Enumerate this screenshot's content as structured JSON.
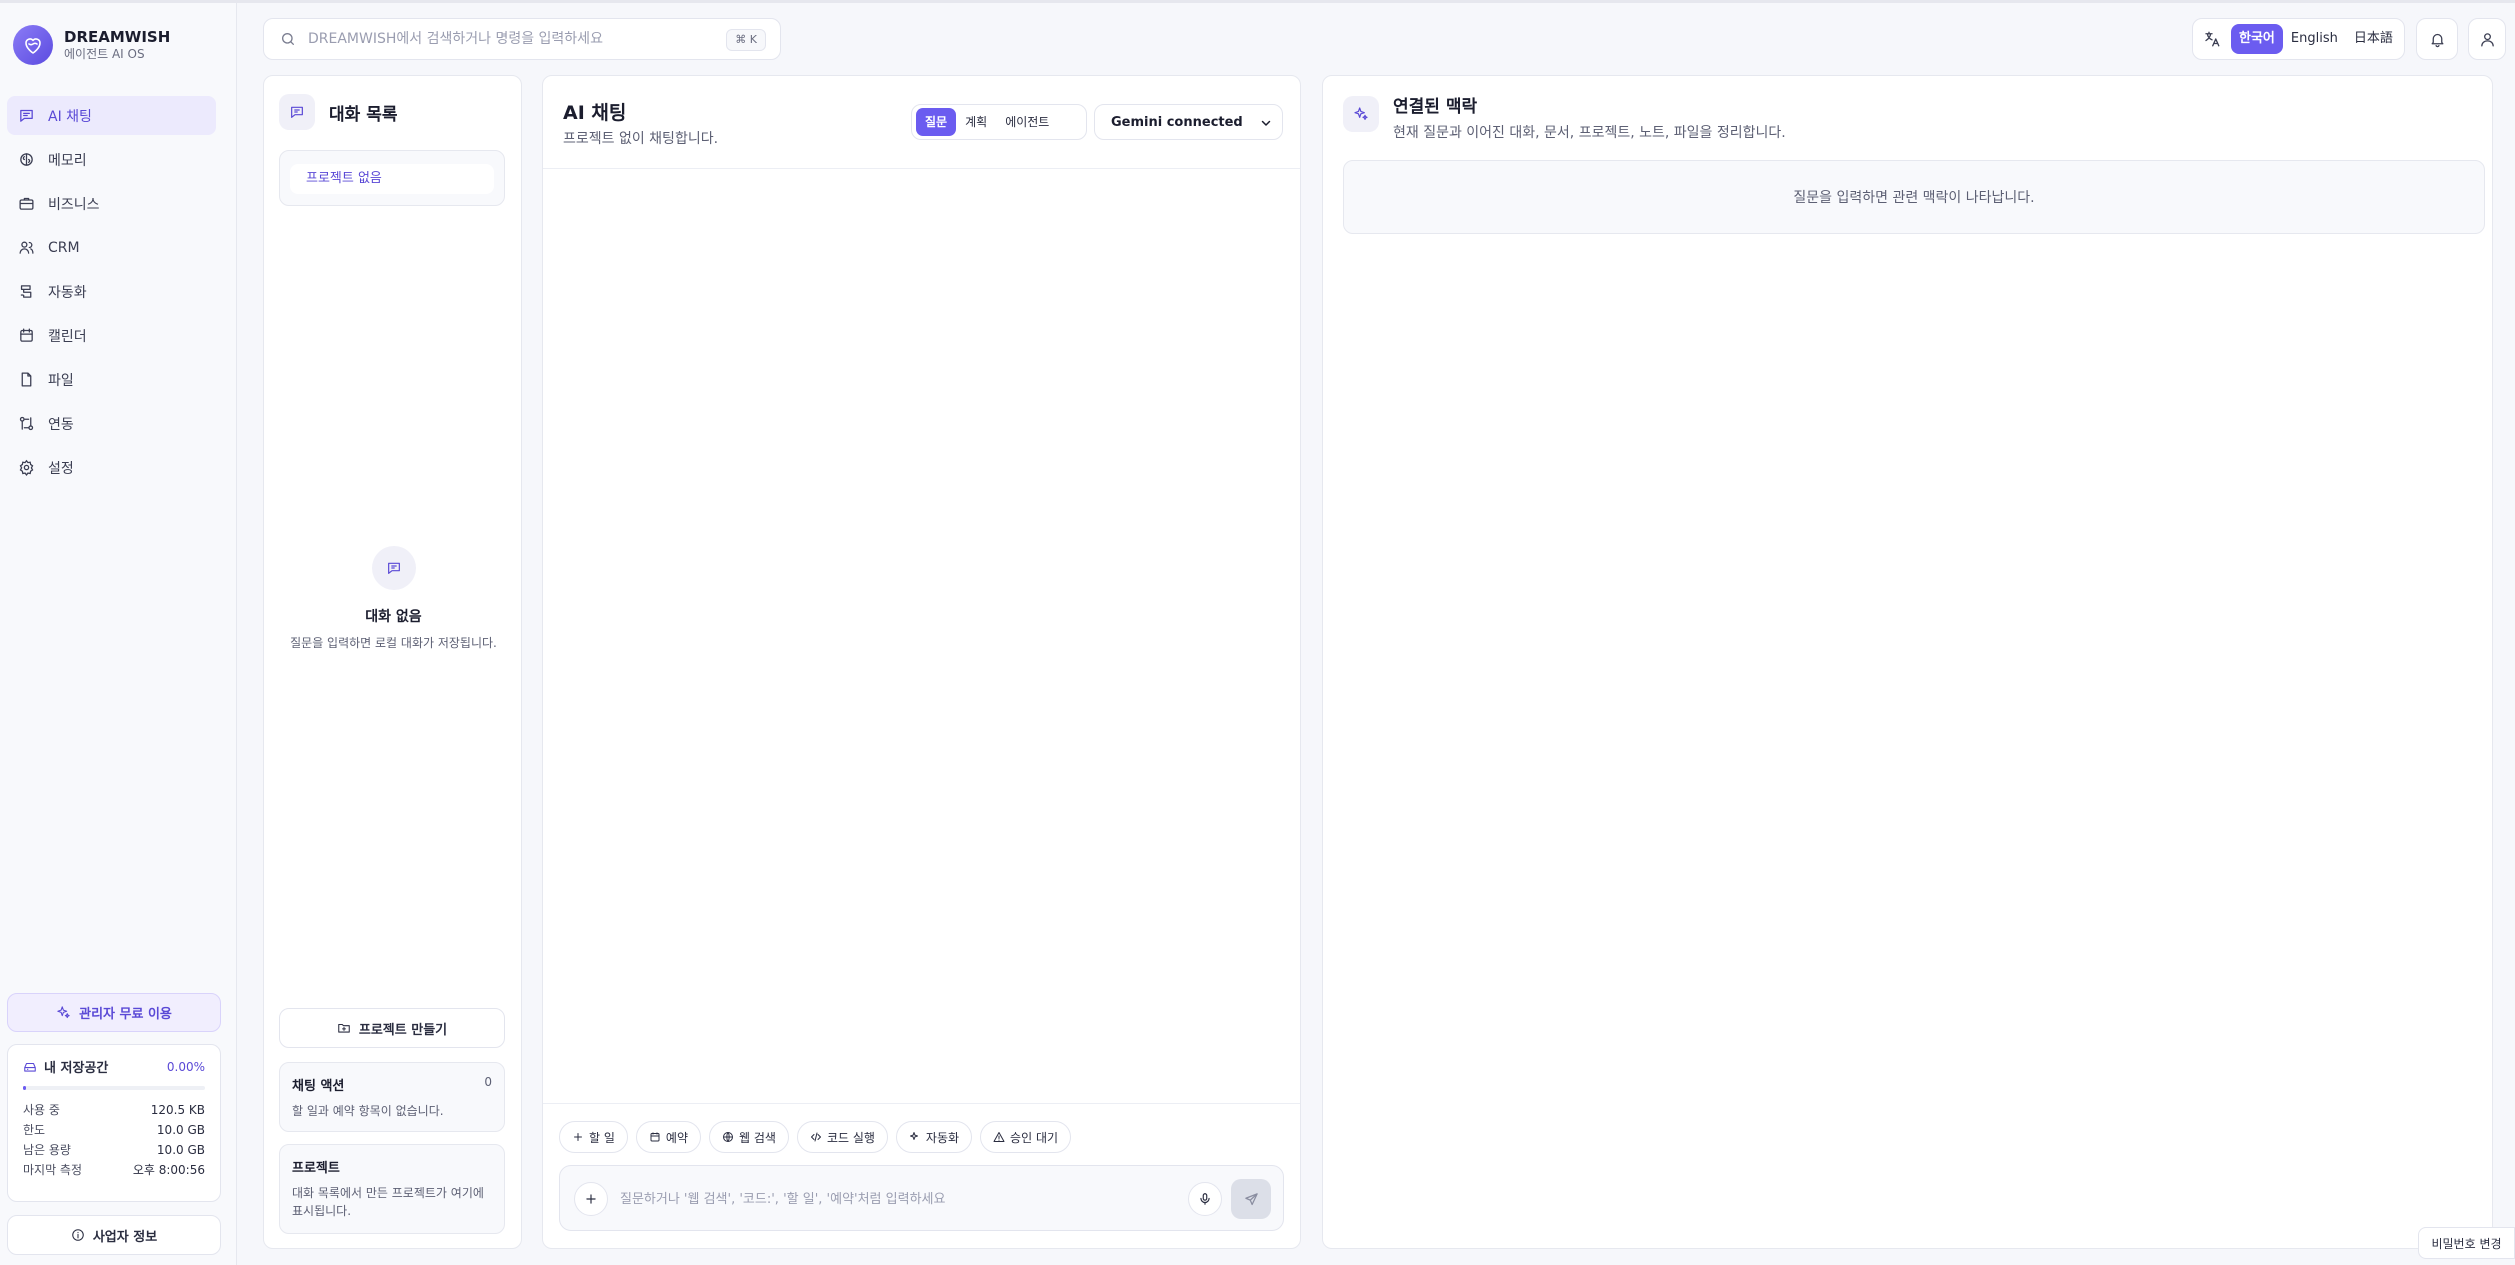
{
  "brand": {
    "name": "DREAMWISH",
    "subtitle": "에이전트 AI OS"
  },
  "sidebar": {
    "items": [
      {
        "label": "AI 채팅",
        "icon": "chat-icon",
        "active": true
      },
      {
        "label": "메모리",
        "icon": "memory-icon"
      },
      {
        "label": "비즈니스",
        "icon": "briefcase-icon"
      },
      {
        "label": "CRM",
        "icon": "users-icon"
      },
      {
        "label": "자동화",
        "icon": "workflow-icon"
      },
      {
        "label": "캘린더",
        "icon": "calendar-icon"
      },
      {
        "label": "파일",
        "icon": "file-icon"
      },
      {
        "label": "연동",
        "icon": "integration-icon"
      },
      {
        "label": "설정",
        "icon": "gear-icon"
      }
    ],
    "admin_free": "관리자 무료 이용",
    "storage": {
      "title": "내 저장공간",
      "percent": "0.00%",
      "used_fraction": 0.0,
      "rows": [
        {
          "label": "사용 중",
          "value": "120.5 KB"
        },
        {
          "label": "한도",
          "value": "10.0 GB"
        },
        {
          "label": "남은 용량",
          "value": "10.0 GB"
        },
        {
          "label": "마지막 측정",
          "value": "오후 8:00:56"
        }
      ]
    },
    "business_info": "사업자 정보"
  },
  "search": {
    "placeholder": "DREAMWISH에서 검색하거나 명령을 입력하세요",
    "shortcut": "⌘ K"
  },
  "languages": {
    "items": [
      "한국어",
      "English",
      "日本語"
    ],
    "active": "한국어"
  },
  "conversations": {
    "title": "대화 목록",
    "project_filter": "프로젝트 없음",
    "empty_title": "대화 없음",
    "empty_desc": "질문을 입력하면 로컬 대화가 저장됩니다.",
    "make_project": "프로젝트 만들기",
    "chat_actions": {
      "title": "채팅 액션",
      "count": "0",
      "desc": "할 일과 예약 항목이 없습니다."
    },
    "projects": {
      "title": "프로젝트",
      "desc": "대화 목록에서 만든 프로젝트가 여기에 표시됩니다."
    }
  },
  "chat": {
    "title": "AI 채팅",
    "subtitle": "프로젝트 없이 채팅합니다.",
    "modes": [
      "질문",
      "계획",
      "에이전트"
    ],
    "active_mode": "질문",
    "model": "Gemini connected",
    "chips": [
      {
        "label": "할 일",
        "icon": "plus-icon"
      },
      {
        "label": "예약",
        "icon": "calendar-icon"
      },
      {
        "label": "웹 검색",
        "icon": "globe-icon"
      },
      {
        "label": "코드 실행",
        "icon": "code-icon"
      },
      {
        "label": "자동화",
        "icon": "sparkle-icon"
      },
      {
        "label": "승인 대기",
        "icon": "warning-icon"
      }
    ],
    "composer_placeholder": "질문하거나 '웹 검색', '코드:', '할 일', '예약'처럼 입력하세요"
  },
  "context": {
    "title": "연결된 맥락",
    "subtitle": "현재 질문과 이어진 대화, 문서, 프로젝트, 노트, 파일을 정리합니다.",
    "empty": "질문을 입력하면 관련 맥락이 나타납니다."
  },
  "password_change": "비밀번호 변경",
  "colors": {
    "accent": "#6b5cf0",
    "accent_light": "#eceafd"
  }
}
